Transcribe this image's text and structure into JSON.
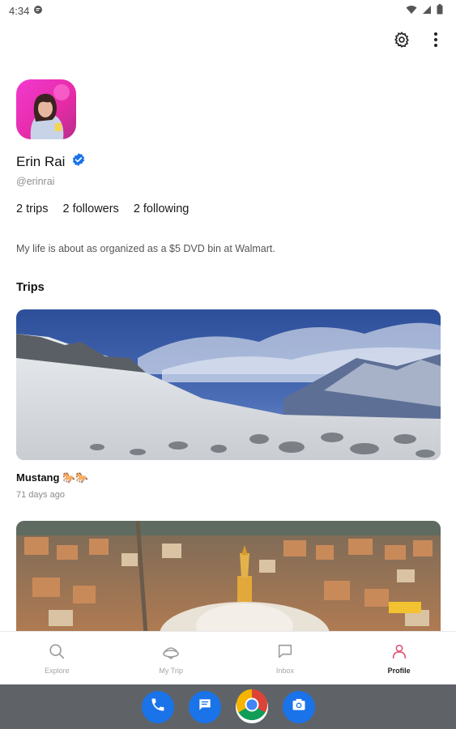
{
  "status_bar": {
    "time": "4:34"
  },
  "profile": {
    "name": "Erin Rai",
    "handle": "@erinrai",
    "verified": true,
    "stats": {
      "trips": "2 trips",
      "followers": "2 followers",
      "following": "2 following"
    },
    "bio": "My life is about as organized as a $5 DVD bin at Walmart."
  },
  "trips_section": {
    "title": "Trips"
  },
  "trips": [
    {
      "title": "Mustang 🐎🐎",
      "time": "71 days ago"
    },
    {
      "title": "",
      "time": ""
    }
  ],
  "bottom_nav": {
    "items": [
      {
        "label": "Explore",
        "icon": "search-icon",
        "active": false
      },
      {
        "label": "My Trip",
        "icon": "trip-icon",
        "active": false
      },
      {
        "label": "Inbox",
        "icon": "chat-icon",
        "active": false
      },
      {
        "label": "Profile",
        "icon": "person-icon",
        "active": true
      }
    ]
  },
  "dock": {
    "apps": [
      "phone-icon",
      "messages-icon",
      "chrome-icon",
      "camera-icon"
    ]
  },
  "colors": {
    "accent_pink": "#e0577a",
    "verified_blue": "#1a73e8"
  }
}
